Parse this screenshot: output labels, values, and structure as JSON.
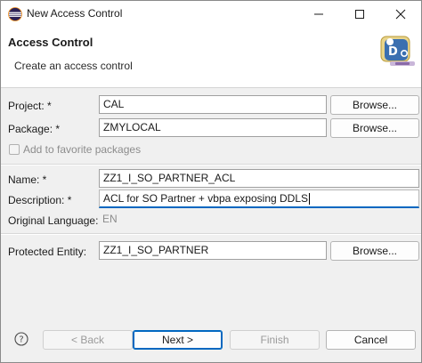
{
  "window": {
    "title": "New Access Control",
    "icon": "eclipse-icon"
  },
  "header": {
    "title": "Access Control",
    "description": "Create an access control",
    "icon": "access-control-wizard-icon"
  },
  "form": {
    "project_label": "Project: *",
    "project_value": "CAL",
    "package_label": "Package: *",
    "package_value": "ZMYLOCAL",
    "favorite_label": "Add to favorite packages",
    "favorite_checked": false,
    "name_label": "Name: *",
    "name_value": "ZZ1_I_SO_PARTNER_ACL",
    "description_label": "Description: *",
    "description_value": "ACL for SO Partner + vbpa exposing DDLS",
    "orig_lang_label": "Original Language:",
    "orig_lang_value": "EN",
    "protected_label": "Protected Entity:",
    "protected_value": "ZZ1_I_SO_PARTNER",
    "browse_label": "Browse..."
  },
  "footer": {
    "back_label": "< Back",
    "next_label": "Next >",
    "finish_label": "Finish",
    "cancel_label": "Cancel",
    "help_icon": "help-icon"
  }
}
